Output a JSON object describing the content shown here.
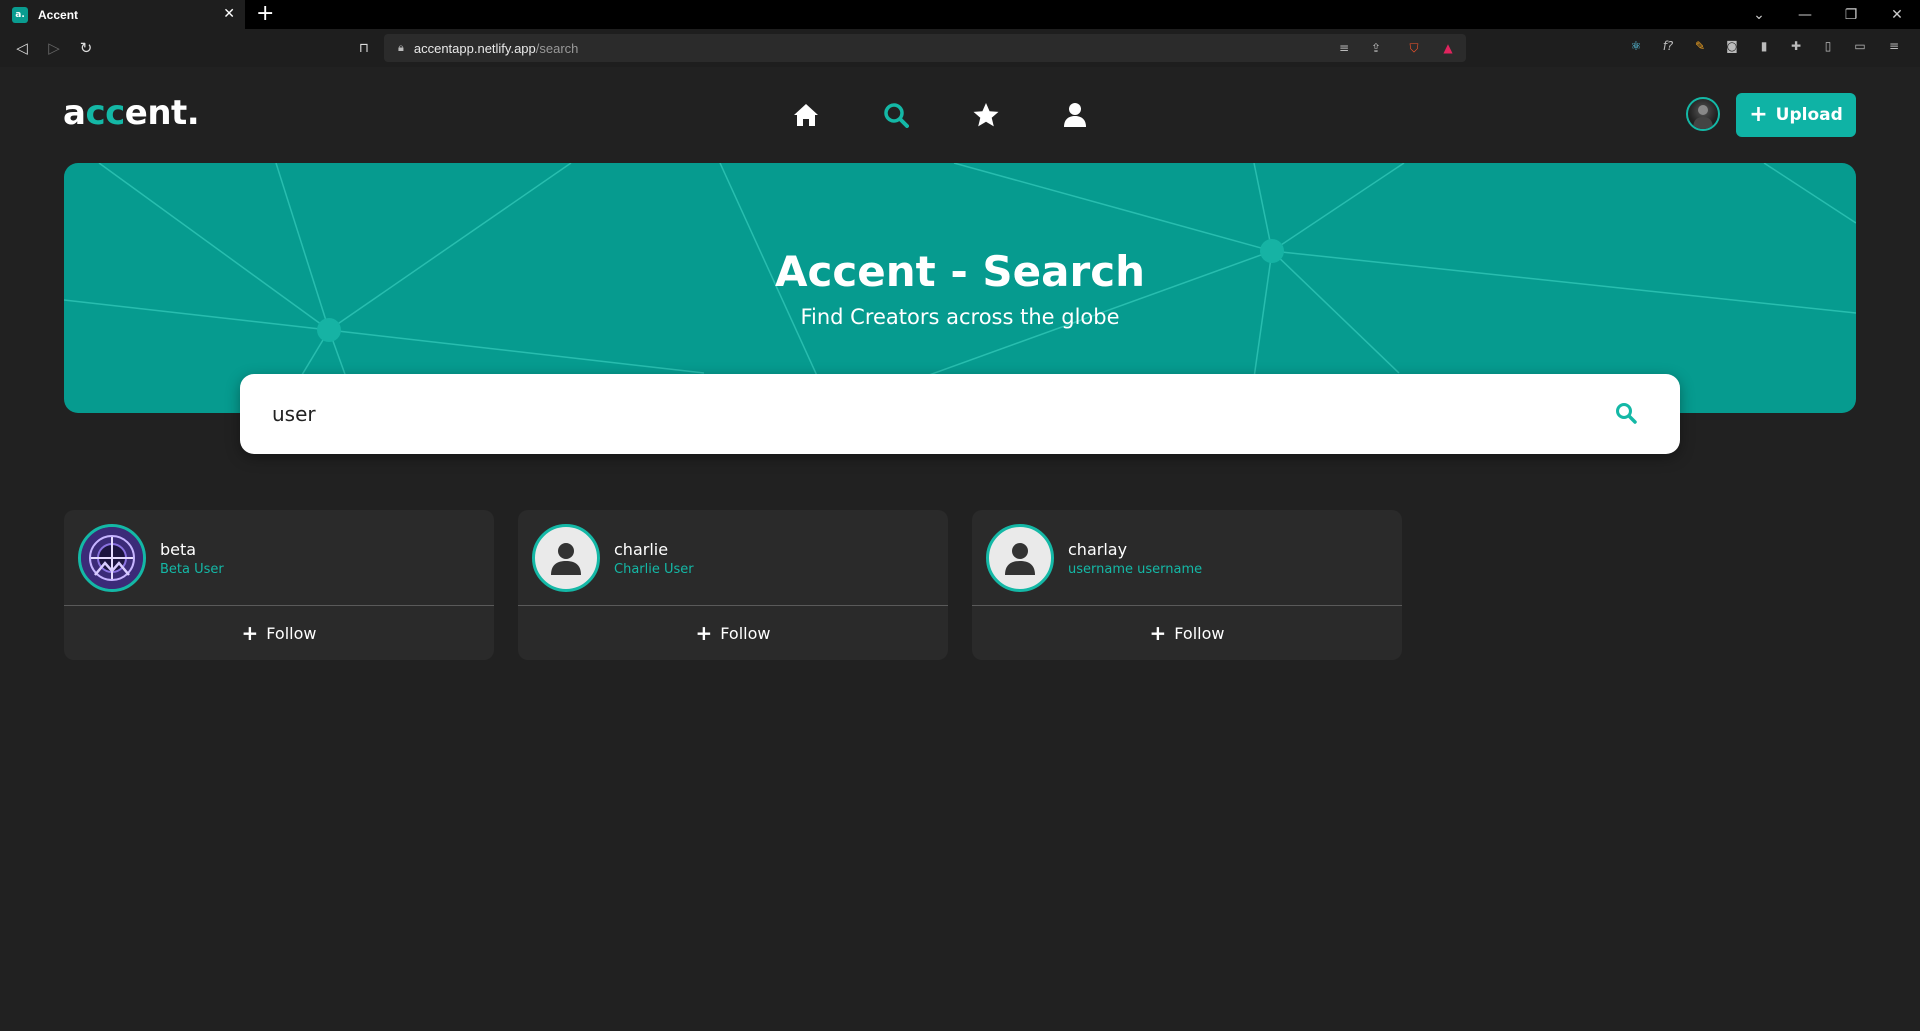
{
  "browser": {
    "tab_title": "Accent",
    "tab_favicon_text": "a.",
    "url_host": "accentapp.netlify.app",
    "url_path": "/search"
  },
  "app": {
    "logo": {
      "part1": "a",
      "part2": "cc",
      "part3": "ent."
    },
    "nav": [
      "home-icon",
      "search-icon",
      "star-icon",
      "user-icon"
    ],
    "active_nav": "search",
    "upload_label": "Upload",
    "accent_color": "#14b8a6"
  },
  "hero": {
    "title": "Accent - Search",
    "subtitle": "Find Creators across the globe"
  },
  "search": {
    "value": "user"
  },
  "results": [
    {
      "username": "beta",
      "full_name": "Beta User",
      "follow_label": "Follow"
    },
    {
      "username": "charlie",
      "full_name": "Charlie User",
      "follow_label": "Follow"
    },
    {
      "username": "charlay",
      "full_name": "username username",
      "follow_label": "Follow"
    }
  ]
}
